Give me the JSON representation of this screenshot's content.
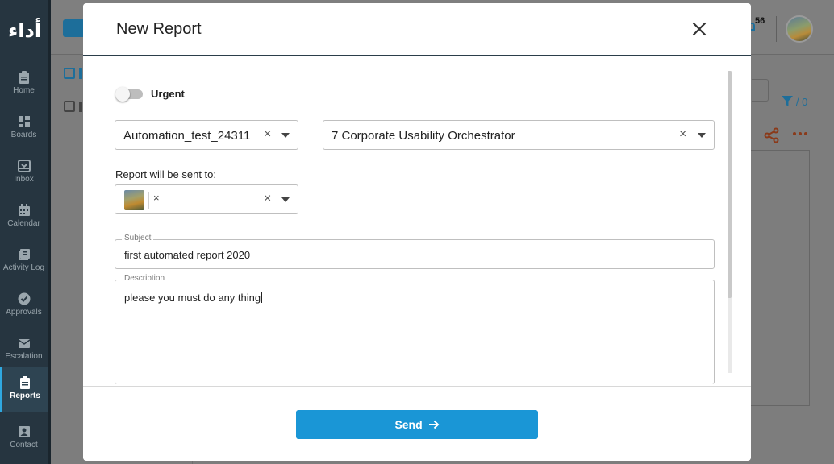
{
  "sidebar": {
    "logo": "أداء",
    "items": [
      {
        "label": "Home",
        "icon": "clipboard-icon"
      },
      {
        "label": "Boards",
        "icon": "grid-icon"
      },
      {
        "label": "Inbox",
        "icon": "inbox-icon"
      },
      {
        "label": "Calendar",
        "icon": "calendar-icon"
      },
      {
        "label": "Activity Log",
        "icon": "list-icon"
      },
      {
        "label": "Approvals",
        "icon": "check-circle-icon"
      },
      {
        "label": "Escalation",
        "icon": "mail-icon"
      },
      {
        "label": "Reports",
        "icon": "report-icon",
        "active": true
      },
      {
        "label": "Contact",
        "icon": "contact-icon"
      }
    ]
  },
  "header": {
    "notification_count": "56"
  },
  "background": {
    "filter_count": "/ 0"
  },
  "modal": {
    "title": "New Report",
    "urgent_label": "Urgent",
    "urgent_on": false,
    "board_select": {
      "value": "Automation_test_24311"
    },
    "card_select": {
      "value": "7 Corporate Usability Orchestrator"
    },
    "sent_to_label": "Report will be sent to:",
    "subject": {
      "legend": "Subject",
      "value": "first automated report 2020"
    },
    "description": {
      "legend": "Description",
      "value": "please you must do any thing"
    },
    "send_label": "Send"
  },
  "colors": {
    "sidebar_bg": "#263540",
    "accent": "#1a96d6",
    "active_indicator": "#2fa8e0"
  }
}
